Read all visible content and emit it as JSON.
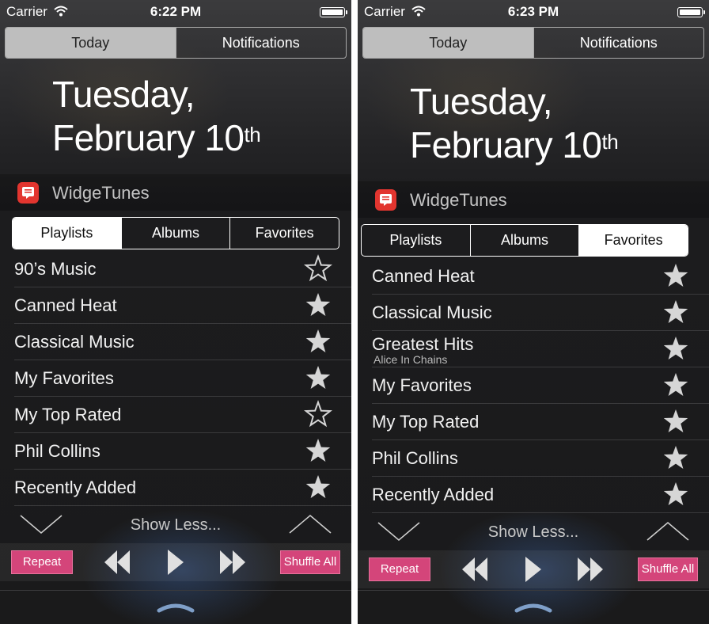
{
  "colors": {
    "accent_pink": "#d4457a",
    "app_icon_red": "#e2352f"
  },
  "screens": [
    {
      "status": {
        "carrier": "Carrier",
        "time": "6:22 PM"
      },
      "top_tabs": [
        "Today",
        "Notifications"
      ],
      "active_top_tab": "Today",
      "date": {
        "line1": "Tuesday,",
        "line2": "February 10",
        "suffix": "th"
      },
      "app_name": "WidgeTunes",
      "segments": [
        "Playlists",
        "Albums",
        "Favorites"
      ],
      "active_segment": "Playlists",
      "items": [
        {
          "title": "90’s Music",
          "favorite": false
        },
        {
          "title": "Canned Heat",
          "favorite": true
        },
        {
          "title": "Classical Music",
          "favorite": true
        },
        {
          "title": "My Favorites",
          "favorite": true
        },
        {
          "title": "My Top Rated",
          "favorite": false
        },
        {
          "title": "Phil Collins",
          "favorite": true
        },
        {
          "title": "Recently Added",
          "favorite": true
        }
      ],
      "show_less": "Show Less...",
      "repeat_label": "Repeat",
      "shuffle_label": "Shuffle All"
    },
    {
      "status": {
        "carrier": "Carrier",
        "time": "6:23 PM"
      },
      "top_tabs": [
        "Today",
        "Notifications"
      ],
      "active_top_tab": "Today",
      "date": {
        "line1": "Tuesday,",
        "line2": "February 10",
        "suffix": "th"
      },
      "app_name": "WidgeTunes",
      "segments": [
        "Playlists",
        "Albums",
        "Favorites"
      ],
      "active_segment": "Favorites",
      "items": [
        {
          "title": "Canned Heat",
          "favorite": true
        },
        {
          "title": "Classical Music",
          "favorite": true
        },
        {
          "title": "Greatest Hits",
          "subtitle": "Alice In Chains",
          "favorite": true
        },
        {
          "title": "My Favorites",
          "favorite": true
        },
        {
          "title": "My Top Rated",
          "favorite": true
        },
        {
          "title": "Phil Collins",
          "favorite": true
        },
        {
          "title": "Recently Added",
          "favorite": true
        }
      ],
      "show_less": "Show Less...",
      "repeat_label": "Repeat",
      "shuffle_label": "Shuffle All"
    }
  ]
}
